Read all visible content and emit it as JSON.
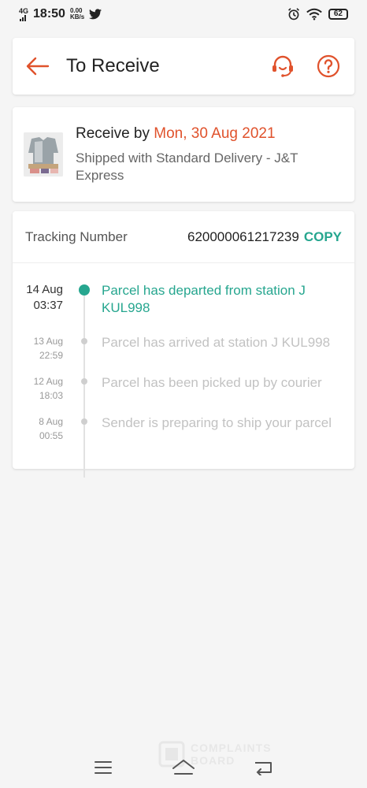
{
  "status_bar": {
    "network": "4G",
    "time": "18:50",
    "speed_value": "0.00",
    "speed_unit": "KB/s",
    "battery": "62"
  },
  "header": {
    "title": "To Receive"
  },
  "delivery": {
    "receive_prefix": "Receive by ",
    "receive_date": "Mon, 30 Aug 2021",
    "shipping_info": "Shipped with Standard Delivery  - J&T Express"
  },
  "tracking": {
    "label": "Tracking Number",
    "number": "620000061217239",
    "copy_label": "COPY",
    "events": [
      {
        "date": "14 Aug",
        "time": "03:37",
        "text": "Parcel has departed from station J KUL998"
      },
      {
        "date": "13 Aug",
        "time": "22:59",
        "text": "Parcel has arrived at station J KUL998"
      },
      {
        "date": "12 Aug",
        "time": "18:03",
        "text": "Parcel has been picked up by courier"
      },
      {
        "date": "8 Aug",
        "time": "00:55",
        "text": "Sender is preparing to ship your parcel"
      }
    ]
  },
  "watermark": {
    "line1": "COMPLAINTS",
    "line2": "BOARD"
  },
  "colors": {
    "accent": "#e0522c",
    "teal": "#26a68f"
  }
}
